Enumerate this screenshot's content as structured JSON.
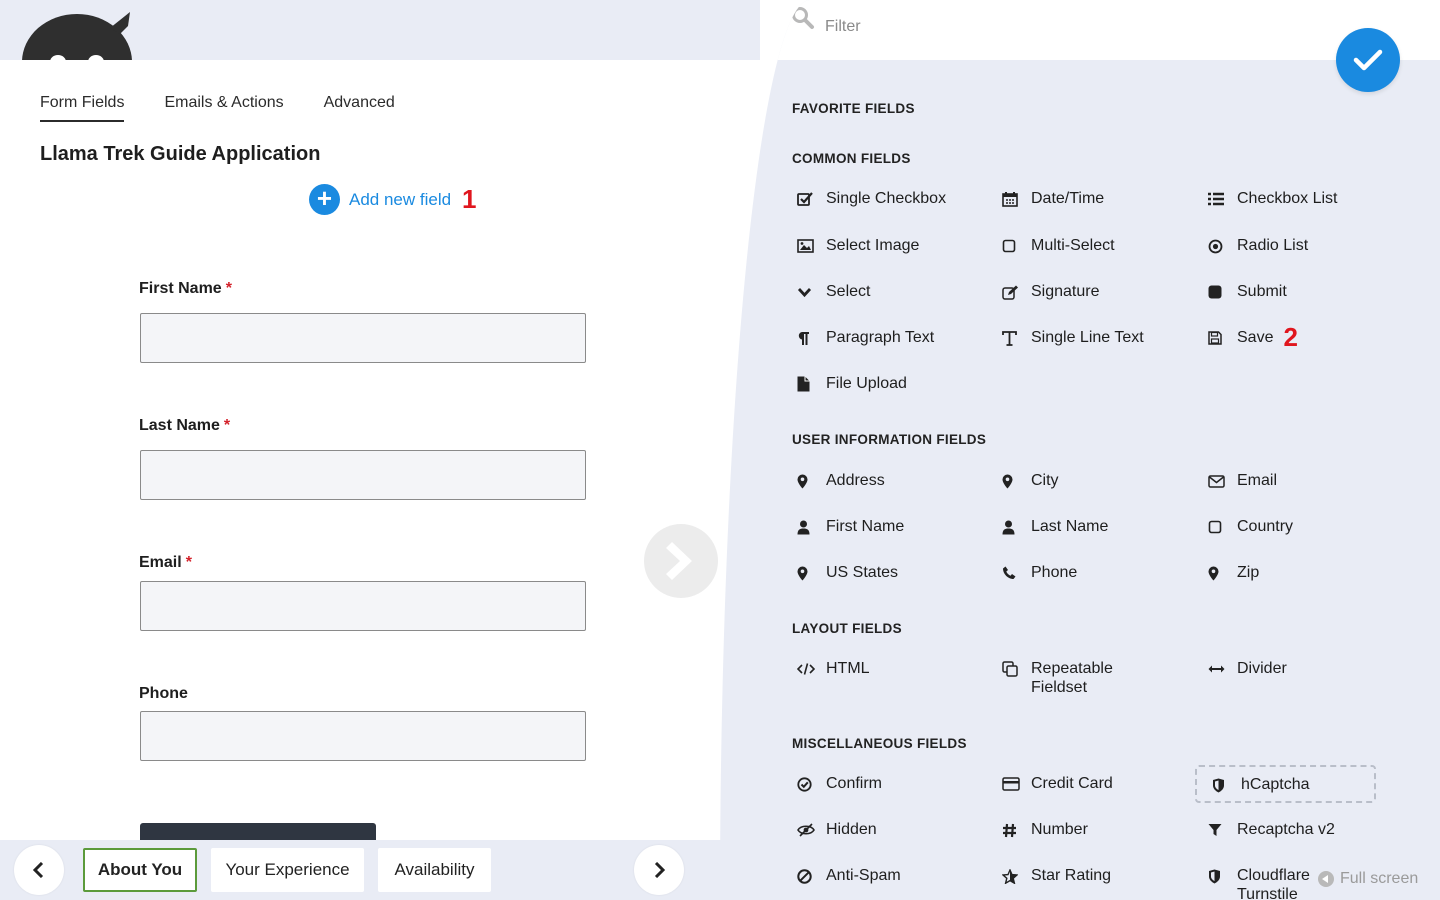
{
  "tabs": [
    "Form Fields",
    "Emails & Actions",
    "Advanced"
  ],
  "form": {
    "title": "Llama Trek Guide Application",
    "add_field_label": "Add new field",
    "add_field_marker": "1",
    "fields": [
      {
        "label": "First Name",
        "required": "*",
        "value": ""
      },
      {
        "label": "Last Name",
        "required": "*",
        "value": ""
      },
      {
        "label": "Email",
        "required": "*",
        "value": ""
      },
      {
        "label": "Phone",
        "required": "",
        "value": ""
      }
    ]
  },
  "pages": [
    "About You",
    "Your Experience",
    "Availability"
  ],
  "drawer": {
    "filter_placeholder": "Filter",
    "sections": {
      "favorite": "FAVORITE FIELDS",
      "common": "COMMON FIELDS",
      "user": "USER INFORMATION FIELDS",
      "layout": "LAYOUT FIELDS",
      "misc": "MISCELLANEOUS FIELDS"
    },
    "common": [
      {
        "label": "Single Checkbox",
        "icon": "checkbox-icon"
      },
      {
        "label": "Date/Time",
        "icon": "calendar-icon"
      },
      {
        "label": "Checkbox List",
        "icon": "list-icon"
      },
      {
        "label": "Select Image",
        "icon": "image-icon"
      },
      {
        "label": "Multi-Select",
        "icon": "square-outline-icon"
      },
      {
        "label": "Radio List",
        "icon": "radio-icon"
      },
      {
        "label": "Select",
        "icon": "chevron-down-icon"
      },
      {
        "label": "Signature",
        "icon": "signature-icon"
      },
      {
        "label": "Submit",
        "icon": "square-filled-icon"
      },
      {
        "label": "Paragraph Text",
        "icon": "paragraph-icon"
      },
      {
        "label": "Single Line Text",
        "icon": "text-cursor-icon"
      },
      {
        "label": "Save",
        "icon": "floppy-disk-icon"
      },
      {
        "label": "File Upload",
        "icon": "file-icon"
      }
    ],
    "save_marker": "2",
    "user": [
      {
        "label": "Address",
        "icon": "map-pin-icon"
      },
      {
        "label": "City",
        "icon": "map-pin-icon"
      },
      {
        "label": "Email",
        "icon": "envelope-icon"
      },
      {
        "label": "First Name",
        "icon": "user-icon"
      },
      {
        "label": "Last Name",
        "icon": "user-icon"
      },
      {
        "label": "Country",
        "icon": "square-outline-icon"
      },
      {
        "label": "US States",
        "icon": "map-pin-icon"
      },
      {
        "label": "Phone",
        "icon": "phone-icon"
      },
      {
        "label": "Zip",
        "icon": "map-pin-icon"
      }
    ],
    "layout": [
      {
        "label": "HTML",
        "icon": "code-icon"
      },
      {
        "label": "Repeatable Fieldset",
        "icon": "copy-icon"
      },
      {
        "label": "Divider",
        "icon": "horizontal-arrows-icon"
      }
    ],
    "misc": [
      {
        "label": "Confirm",
        "icon": "check-circle-icon"
      },
      {
        "label": "Credit Card",
        "icon": "credit-card-icon"
      },
      {
        "label": "hCaptcha",
        "icon": "shield-icon"
      },
      {
        "label": "Hidden",
        "icon": "eye-slash-icon"
      },
      {
        "label": "Number",
        "icon": "hash-icon"
      },
      {
        "label": "Recaptcha v2",
        "icon": "filter-icon"
      },
      {
        "label": "Anti-Spam",
        "icon": "ban-icon"
      },
      {
        "label": "Star Rating",
        "icon": "star-icon"
      },
      {
        "label": "Cloudflare Turnstile",
        "icon": "shield-icon"
      }
    ],
    "fullscreen_label": "Full screen"
  },
  "colors": {
    "accent": "#1a8ae0",
    "required": "#d3212a",
    "marker": "#e0161e",
    "active_page_border": "#5c9b3b",
    "panel_bg": "#e9ecf5"
  }
}
